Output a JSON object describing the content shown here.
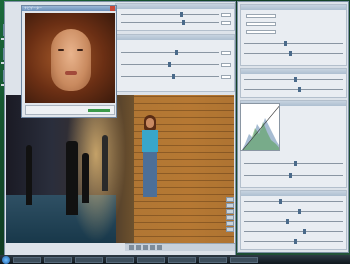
{
  "navigator": {
    "title": "ナビゲーター"
  },
  "taskbar": {
    "items": [
      "",
      "",
      "",
      "",
      "",
      "",
      "",
      ""
    ],
    "clock": ""
  }
}
